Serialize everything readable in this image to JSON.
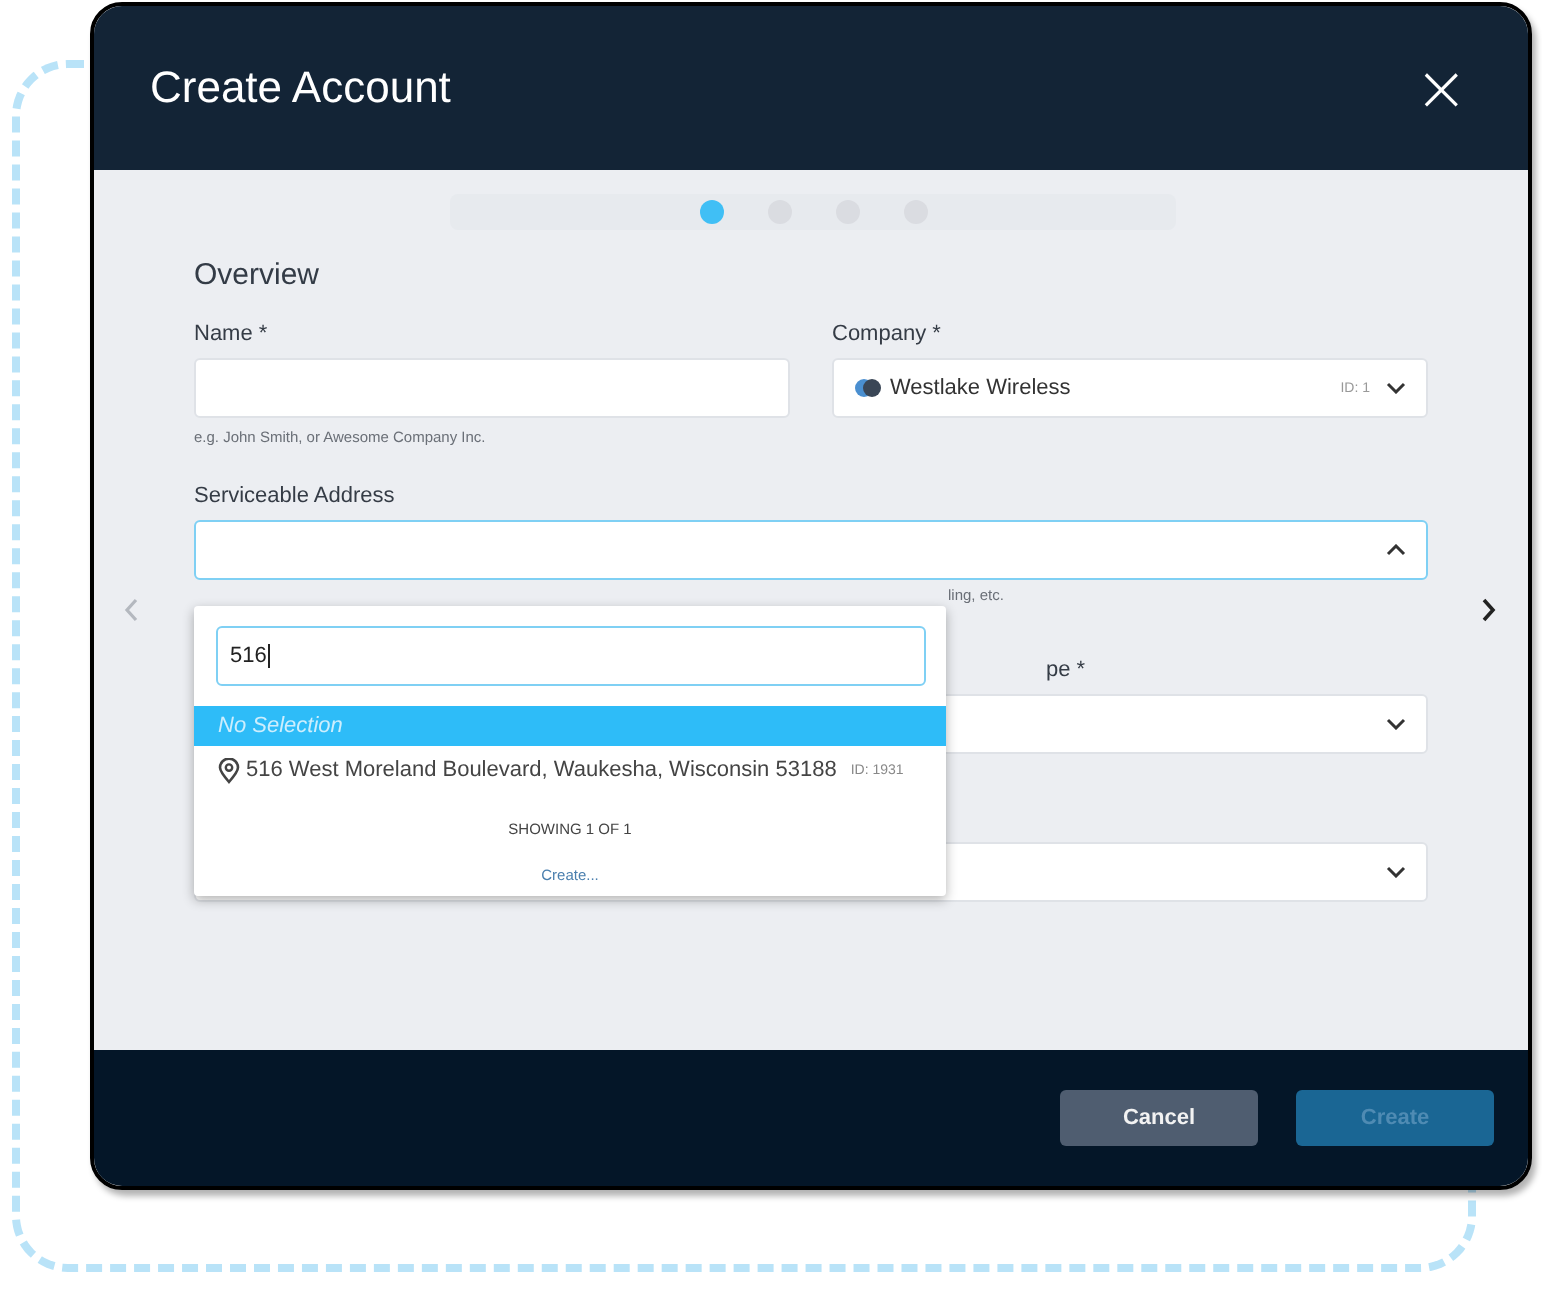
{
  "dialog": {
    "title": "Create Account",
    "close": "×"
  },
  "steps": [
    {
      "selected": true
    },
    {
      "selected": false
    },
    {
      "selected": false
    },
    {
      "selected": false
    }
  ],
  "section_title": "Overview",
  "name_field": {
    "label": "Name *",
    "hint": "e.g. John Smith, or Awesome Company Inc."
  },
  "company_field": {
    "label": "Company *",
    "value": "Westlake Wireless",
    "id_badge": "ID: 1"
  },
  "address_field": {
    "label": "Serviceable Address",
    "expanded": true,
    "hint_visible_part": "ling, etc."
  },
  "type_field": {
    "label_visible_part": "pe *"
  },
  "dropdown": {
    "search_value": "516",
    "options": [
      {
        "kind": "empty",
        "text": "No Selection",
        "selected": true
      },
      {
        "kind": "address",
        "text": "516 West Moreland Boulevard, Waukesha, Wisconsin 53188",
        "id_badge": "ID: 1931",
        "selected": false
      }
    ],
    "count_text": "SHOWING 1 OF 1",
    "create_link": "Create..."
  },
  "nav": {
    "prev_disabled": true,
    "next_disabled": false
  },
  "buttons": [
    {
      "kind": "secondary",
      "label": "Cancel",
      "disabled": false
    },
    {
      "kind": "primary",
      "label": "Create",
      "disabled": true
    }
  ]
}
